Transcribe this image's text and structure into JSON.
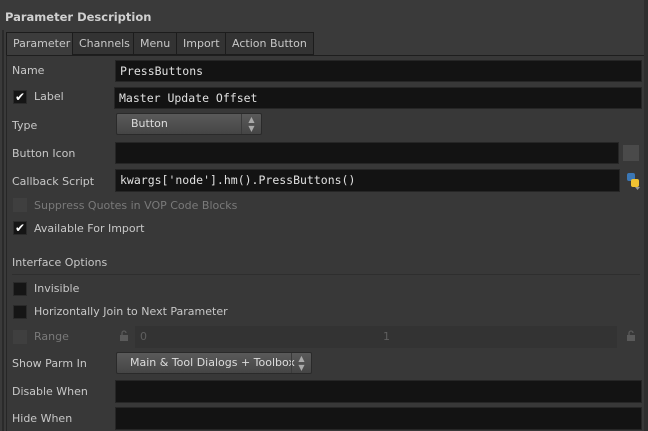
{
  "header": {
    "title": "Parameter Description"
  },
  "tabs": [
    {
      "label": "Parameter"
    },
    {
      "label": "Channels"
    },
    {
      "label": "Menu"
    },
    {
      "label": "Import"
    },
    {
      "label": "Action Button"
    }
  ],
  "fields": {
    "name": {
      "label": "Name",
      "value": "PressButtons"
    },
    "label": {
      "label": "Label",
      "value": "Master Update Offset",
      "checked": true
    },
    "type": {
      "label": "Type",
      "value": "Button"
    },
    "button_icon": {
      "label": "Button Icon",
      "value": ""
    },
    "callback": {
      "label": "Callback Script",
      "value": "kwargs['node'].hm().PressButtons()"
    },
    "suppress": {
      "label": "Suppress Quotes in VOP Code Blocks",
      "checked": false
    },
    "available": {
      "label": "Available For Import",
      "checked": true,
      "mark": "✔"
    },
    "interface_options": "Interface Options",
    "invisible": {
      "label": "Invisible",
      "checked": false
    },
    "hjoin": {
      "label": "Horizontally Join to Next Parameter",
      "checked": false
    },
    "range": {
      "label": "Range",
      "min": "0",
      "max": "1"
    },
    "show_parm_in": {
      "label": "Show Parm In",
      "value": "Main & Tool Dialogs + Toolbox"
    },
    "disable_when": {
      "label": "Disable When",
      "value": ""
    },
    "hide_when": {
      "label": "Hide When",
      "value": ""
    }
  },
  "icons": {
    "check": "✔",
    "updown": "▲▼",
    "lock": "🔒"
  }
}
